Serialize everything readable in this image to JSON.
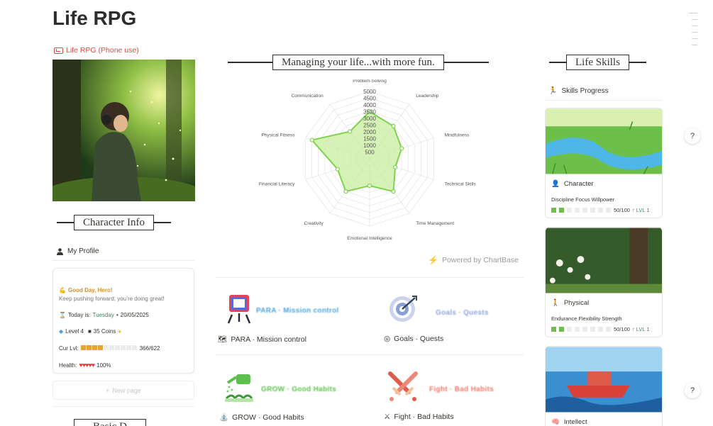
{
  "page": {
    "title": "Life RPG"
  },
  "left": {
    "link": "Life RPG (Phone use)",
    "character_info_heading": "Character Info",
    "my_profile": "My Profile",
    "profile": {
      "greeting": "Good Day, Hero!",
      "encouragement": "Keep pushing forward; you’re doing great!",
      "today_prefix": "Today is:",
      "weekday": "Tuesday",
      "date": "20/05/2025",
      "level": "Level 4",
      "coins": "35 Coins",
      "cur_lvl_label": "Cur Lvl:",
      "cur_lvl_progress": "366/622",
      "cur_lvl_fraction": 0.59,
      "health_label": "Health:",
      "health_value": "100%",
      "hearts": "♥♥♥♥♥"
    },
    "new_page": "New page",
    "next_heading": "Basic D"
  },
  "center": {
    "heading": "Managing your life...with more fun.",
    "powered_by": "Powered by ChartBase",
    "tiles": [
      {
        "blur": "PARA · Mission control",
        "label": "PARA · Mission control"
      },
      {
        "blur": "Goals · Quests",
        "label": "Goals · Quests"
      },
      {
        "blur": "GROW · Good Habits",
        "label": "GROW · Good Habits"
      },
      {
        "blur": "Fight · Bad Habits",
        "label": "Fight · Bad Habits"
      }
    ]
  },
  "chart_data": {
    "type": "radar",
    "axes": [
      "Problem-Solving",
      "Leadership",
      "Mindfulness",
      "Technical Skills",
      "Time Management",
      "Emotional Intelligence",
      "Creativity",
      "Financial Literacy",
      "Physical Fitness",
      "Communication"
    ],
    "values": [
      3500,
      3000,
      2500,
      2000,
      3000,
      2000,
      3000,
      2500,
      4500,
      2500
    ],
    "tick_labels": [
      "5000",
      "4500",
      "4000",
      "3500",
      "3000",
      "2500",
      "2000",
      "1500",
      "1000",
      "500"
    ],
    "rlim": [
      0,
      5000
    ],
    "colors": {
      "fill": "#c9ee9f",
      "stroke": "#7dd34d"
    }
  },
  "right": {
    "heading": "Life Skills",
    "skills_progress": "Skills Progress",
    "skills": [
      {
        "name": "Character",
        "traits": "Discipline Focus Willpower",
        "progress": "50/100",
        "level": "↑ LVL 1"
      },
      {
        "name": "Physical",
        "traits": "Endurance Flexibility Strength",
        "progress": "50/100",
        "level": "↑ LVL 1"
      },
      {
        "name": "Intellect"
      }
    ]
  }
}
